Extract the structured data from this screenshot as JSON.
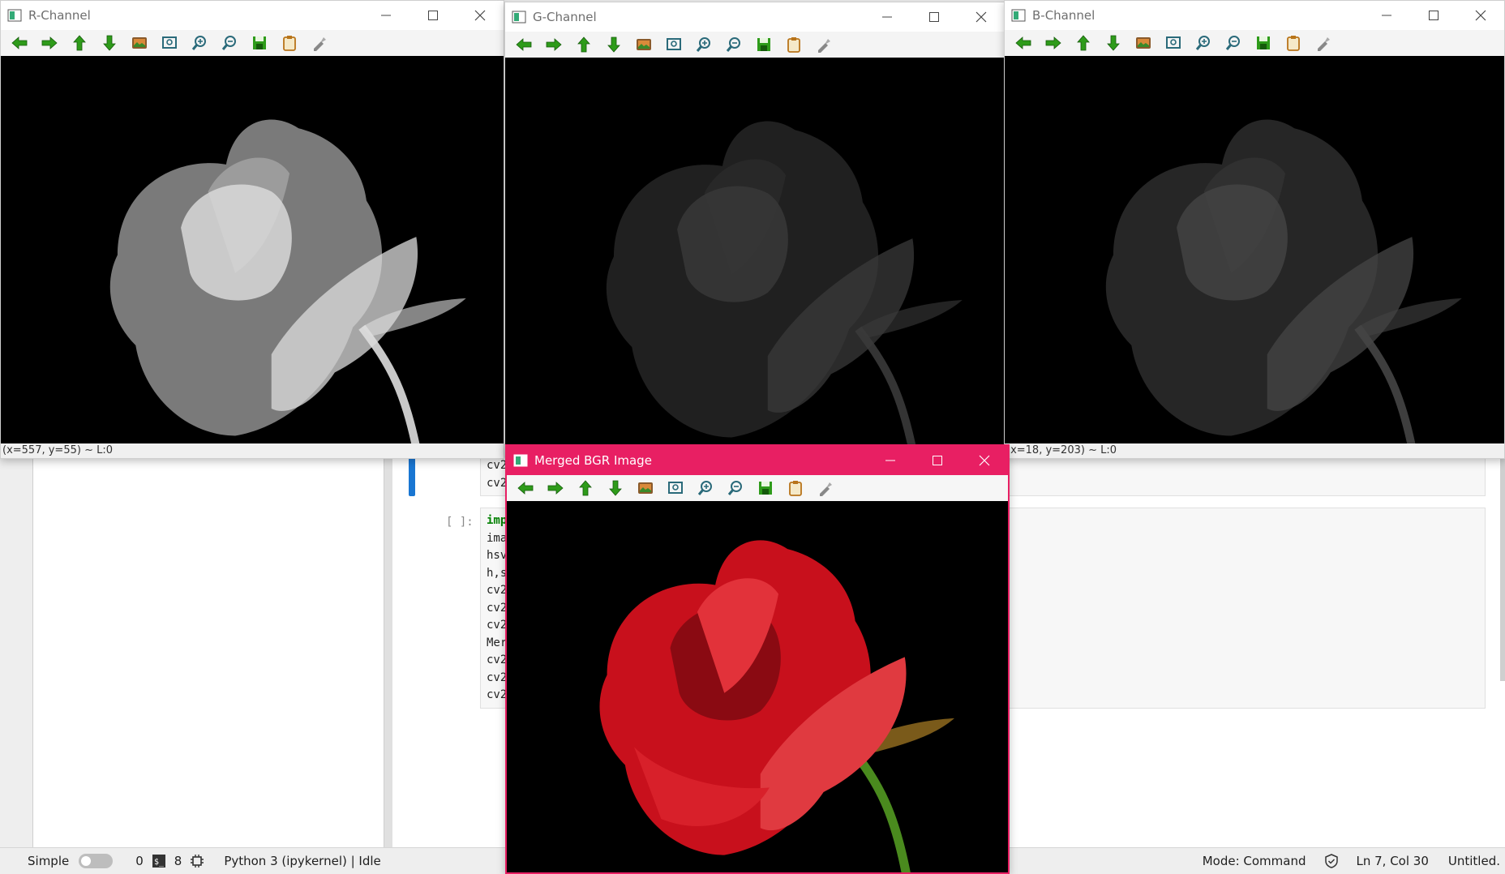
{
  "notebook": {
    "cell1_lines": [
      "cv2",
      "cv2"
    ],
    "cell2_prompt": "[ ]:",
    "cell2_lines": [
      "imp",
      "ima",
      "hsv",
      "h,s",
      "cv2",
      "cv2",
      "cv2",
      "Mer",
      "cv2",
      "cv2",
      "cv2"
    ]
  },
  "windows": {
    "r": {
      "title": "R-Channel",
      "readout": "(x=557, y=55) ~ L:0"
    },
    "g": {
      "title": "G-Channel"
    },
    "b": {
      "title": "B-Channel",
      "readout": "(x=18, y=203) ~ L:0"
    },
    "m": {
      "title": "Merged BGR Image"
    }
  },
  "toolbar_icons": [
    "pan-left-icon",
    "pan-right-icon",
    "pan-up-icon",
    "pan-down-icon",
    "zoom-image-icon",
    "zoom-fit-icon",
    "zoom-in-icon",
    "zoom-out-icon",
    "save-icon",
    "copy-icon",
    "properties-icon"
  ],
  "statusbar": {
    "mode_label": "Simple",
    "terminals_count": "0",
    "kernels_count": "8",
    "kernel_status": "Python 3 (ipykernel) | Idle",
    "mode": "Mode: Command",
    "cursor": "Ln 7, Col 30",
    "filename": "Untitled."
  },
  "colors": {
    "accent": "#e81f63",
    "active_cell": "#1976d2",
    "arrow_green": "#2e9b1a",
    "rose_red": "#d4141e"
  }
}
